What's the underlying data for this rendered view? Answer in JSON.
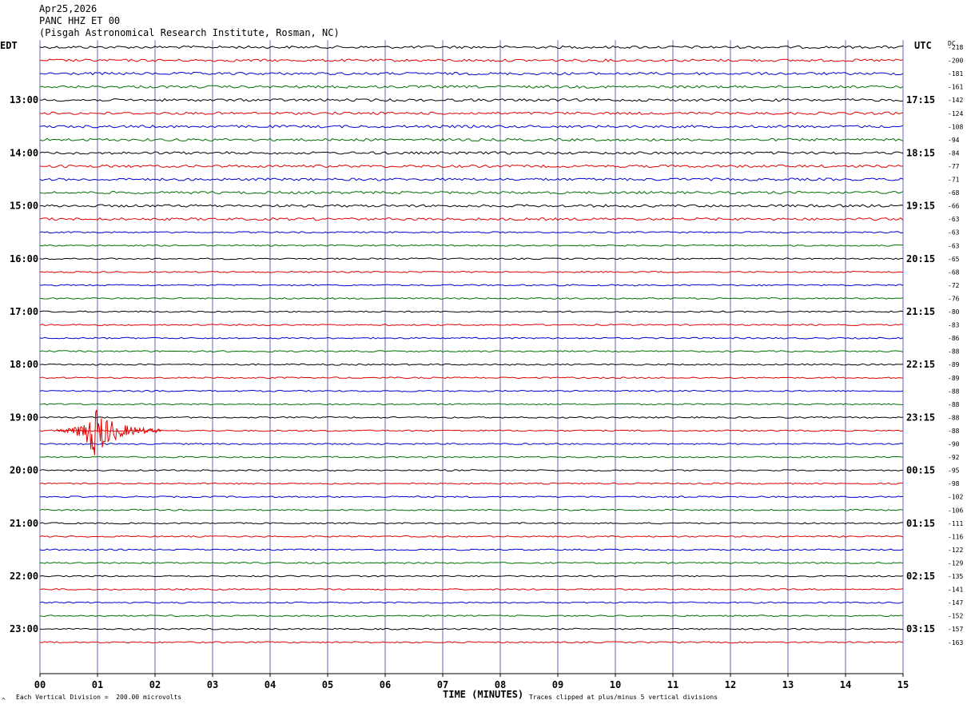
{
  "header": {
    "date": "Apr25,2026",
    "channel": "PANC HHZ ET 00",
    "station": "(Pisgah Astronomical Research Institute, Rosman, NC)"
  },
  "labels": {
    "left_zone": "EDT",
    "right_zone": "UTC",
    "dc_header": "DC",
    "x_title": "TIME (MINUTES)",
    "footer_left": "Each Vertical Division =  200.00 microvolts",
    "footer_right": "Traces clipped at plus/minus 5 vertical divisions",
    "corner_mark": "^"
  },
  "chart_data": {
    "type": "line",
    "title": "PANC HHZ ET 00",
    "xlabel": "TIME (MINUTES)",
    "xlim": [
      0,
      15
    ],
    "x_ticks": [
      "00",
      "01",
      "02",
      "03",
      "04",
      "05",
      "06",
      "07",
      "08",
      "09",
      "10",
      "11",
      "12",
      "13",
      "14",
      "15"
    ],
    "left_time_labels": [
      "13:00",
      "14:00",
      "15:00",
      "16:00",
      "17:00",
      "18:00",
      "19:00",
      "20:00",
      "21:00",
      "22:00",
      "23:00"
    ],
    "right_time_labels": [
      "17:15",
      "18:15",
      "19:15",
      "20:15",
      "21:15",
      "22:15",
      "23:15",
      "00:15",
      "01:15",
      "02:15",
      "03:15"
    ],
    "dc_offsets": [
      "-218",
      "-200",
      "-181",
      "-161",
      "-142",
      "-124",
      "-108",
      "-94",
      "-84",
      "-77",
      "-71",
      "-68",
      "-66",
      "-63",
      "-63",
      "-63",
      "-65",
      "-68",
      "-72",
      "-76",
      "-80",
      "-83",
      "-86",
      "-88",
      "-89",
      "-89",
      "-88",
      "-88",
      "-88",
      "-88",
      "-90",
      "-92",
      "-95",
      "-98",
      "-102",
      "-106",
      "-111",
      "-116",
      "-122",
      "-129",
      "-135",
      "-141",
      "-147",
      "-152",
      "-157",
      "-163"
    ],
    "trace_colors": [
      "#000000",
      "#e00000",
      "#0000d0",
      "#007000"
    ],
    "events": [
      {
        "row": 29,
        "start_min": 0.3,
        "end_min": 2.1,
        "peak_min": 0.95,
        "label": "seismic event"
      }
    ]
  }
}
